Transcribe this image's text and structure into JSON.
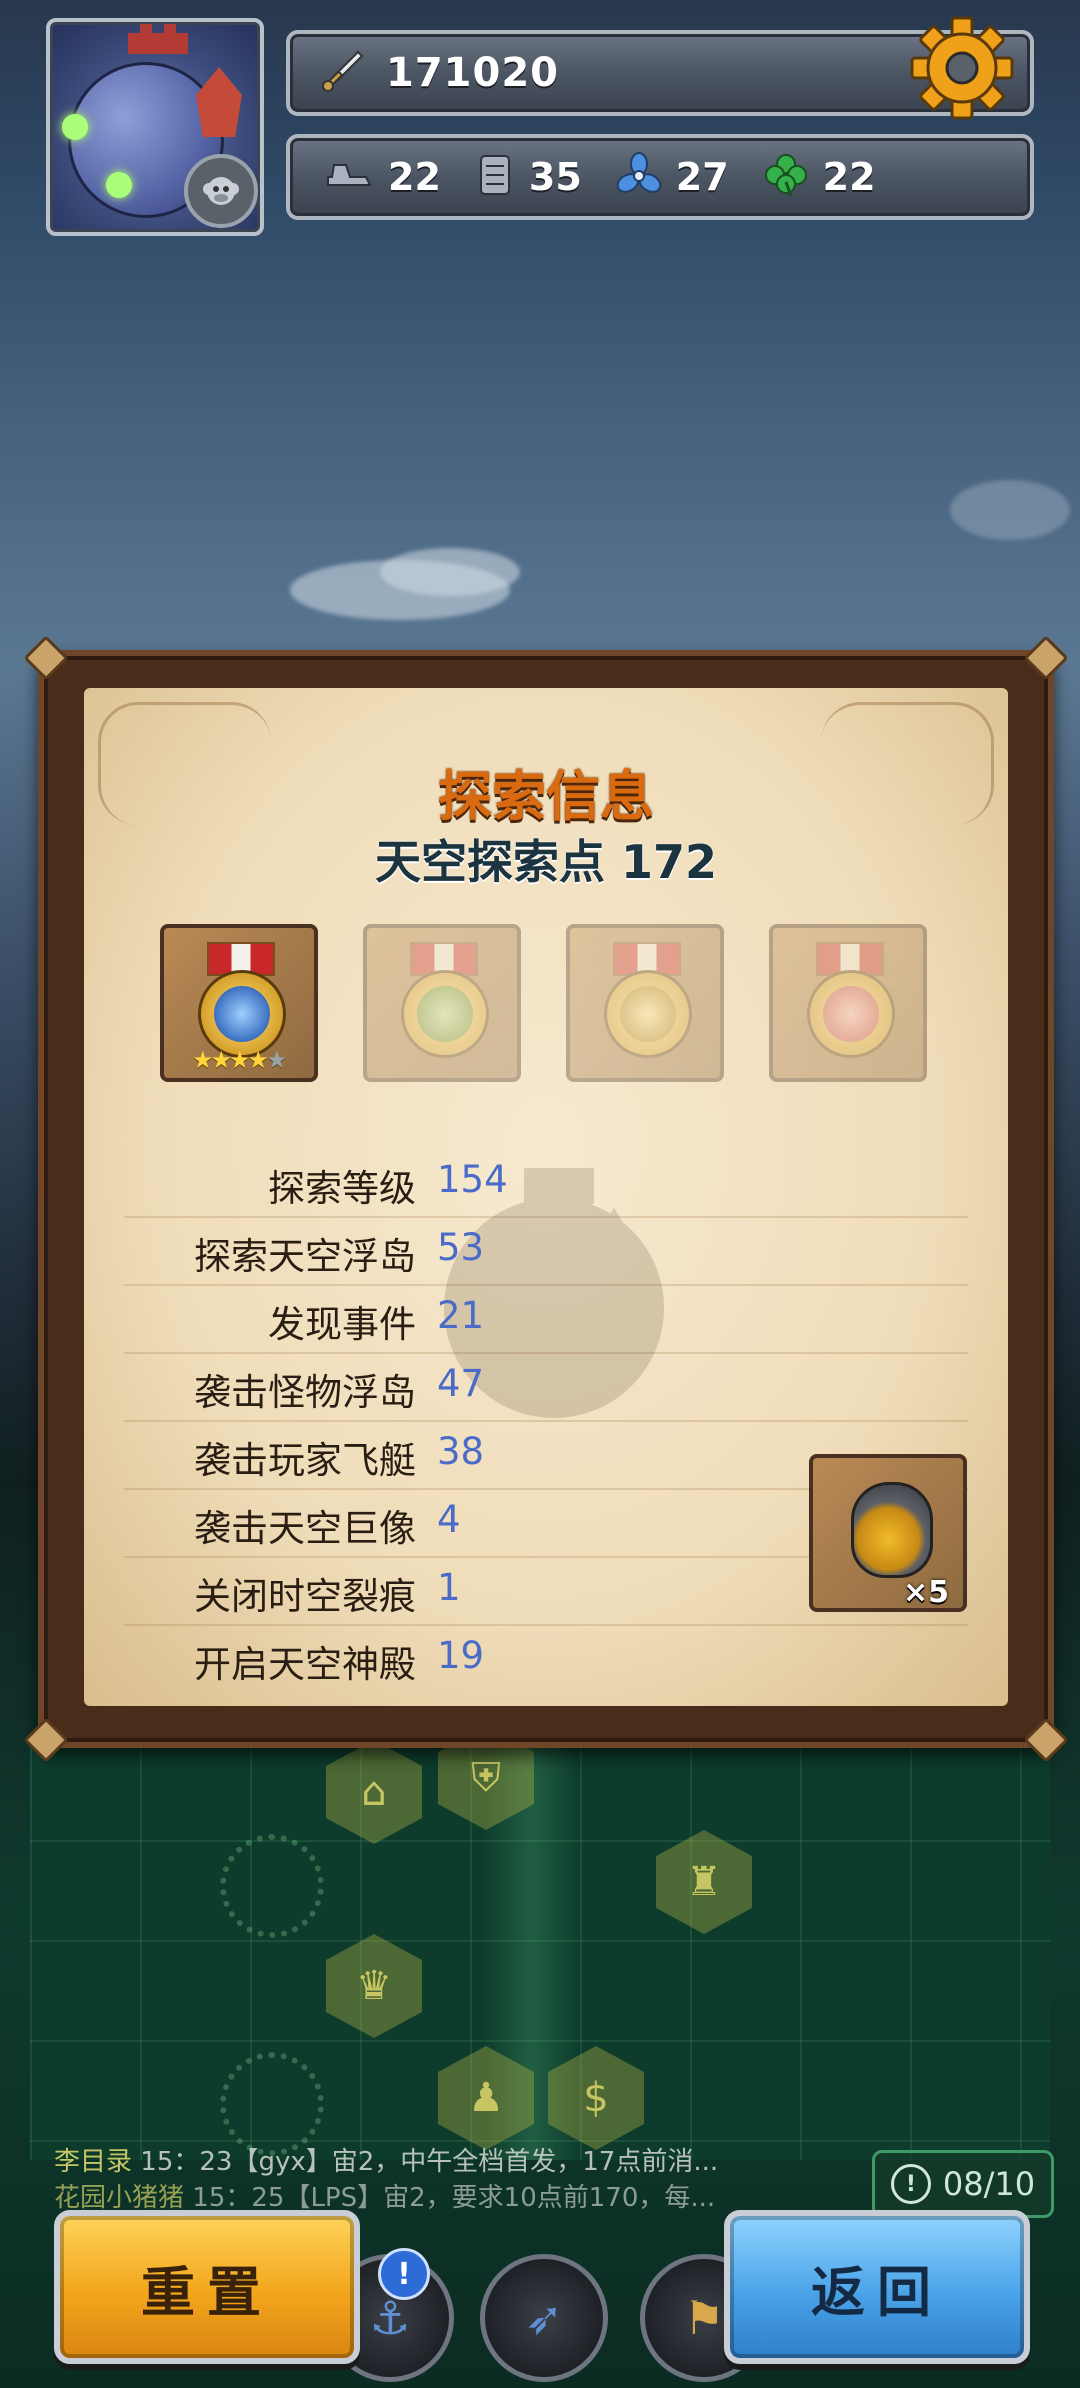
{
  "hud": {
    "power": "171020",
    "resources": [
      {
        "icon": "ship-engine-icon",
        "value": "22"
      },
      {
        "icon": "armor-plate-icon",
        "value": "35"
      },
      {
        "icon": "propeller-icon",
        "value": "27"
      },
      {
        "icon": "clover-icon",
        "value": "22"
      }
    ]
  },
  "panel": {
    "title": "探索信息",
    "subtitle": "天空探索点 172",
    "medals": [
      {
        "icon": "blue-medal-icon",
        "stars_filled": 4,
        "stars_total": 5,
        "locked": false
      },
      {
        "icon": "green-medal-icon",
        "locked": true
      },
      {
        "icon": "gold-medal-icon",
        "locked": true
      },
      {
        "icon": "pink-medal-icon",
        "locked": true
      }
    ],
    "stats": [
      {
        "label": "探索等级",
        "value": "154"
      },
      {
        "label": "探索天空浮岛",
        "value": "53"
      },
      {
        "label": "发现事件",
        "value": "21"
      },
      {
        "label": "袭击怪物浮岛",
        "value": "47"
      },
      {
        "label": "袭击玩家飞艇",
        "value": "38"
      },
      {
        "label": "袭击天空巨像",
        "value": "4"
      },
      {
        "label": "关闭时空裂痕",
        "value": "1"
      },
      {
        "label": "开启天空神殿",
        "value": "19"
      }
    ],
    "reward": {
      "icon": "treasure-pot-icon",
      "quantity": "×5"
    }
  },
  "chat": [
    {
      "name": "李目录",
      "text": "15：23【gyx】宙2，中午全档首发，17点前消..."
    },
    {
      "name": "花园小猪猪",
      "text": "15：25【LPS】宙2，要求10点前170，每..."
    }
  ],
  "counter": {
    "icon": "alert-icon",
    "value": "08/10"
  },
  "buttons": {
    "reset": "重置",
    "back": "返回"
  },
  "colors": {
    "title": "#d96a10",
    "stat_value": "#4a6cc8",
    "reset": "#f2a51b",
    "back": "#4aa3e8"
  }
}
